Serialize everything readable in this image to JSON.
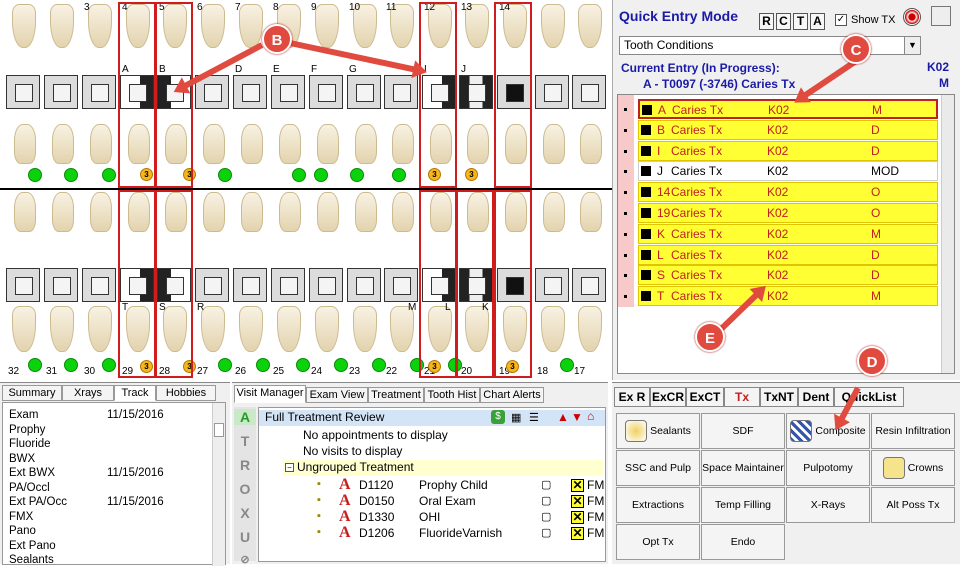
{
  "chart": {
    "upper_numbers": [
      "3",
      "4",
      "5",
      "6",
      "7",
      "8",
      "9",
      "10",
      "11",
      "12",
      "13",
      "14"
    ],
    "upper_letters": [
      "A",
      "B",
      "D",
      "E",
      "F",
      "G",
      "I",
      "J"
    ],
    "lower_numbers": [
      "32",
      "31",
      "30",
      "29",
      "28",
      "27",
      "26",
      "25",
      "24",
      "23",
      "22",
      "21",
      "20",
      "19",
      "18",
      "17"
    ],
    "lower_letters": [
      "T",
      "S",
      "R",
      "M",
      "L",
      "K"
    ],
    "badge": "3",
    "upper_badge_pos": [
      140,
      183,
      428,
      465
    ],
    "lower_badge_pos": [
      140,
      183,
      428,
      506
    ]
  },
  "callouts": {
    "b": "B",
    "c": "C",
    "d": "D",
    "e": "E"
  },
  "quick_entry": {
    "title": "Quick Entry Mode",
    "buttons": [
      "R",
      "C",
      "T",
      "A"
    ],
    "show_tx_label": "Show TX",
    "show_tx_checked": "✓",
    "dropdown_value": "Tooth Conditions",
    "current_entry_label": "Current Entry (In Progress):",
    "current_entry_detail": "A - T0097  (-3746)    Caries Tx",
    "code": "K02",
    "surface": "M"
  },
  "entries": [
    {
      "tooth": "A",
      "cond": "Caries Tx",
      "code": "K02",
      "surf": "M",
      "state": "first"
    },
    {
      "tooth": "B",
      "cond": "Caries Tx",
      "code": "K02",
      "surf": "D",
      "state": "yellow"
    },
    {
      "tooth": "I",
      "cond": "Caries Tx",
      "code": "K02",
      "surf": "D",
      "state": "yellow"
    },
    {
      "tooth": "J",
      "cond": "Caries Tx",
      "code": "K02",
      "surf": "MOD",
      "state": "white"
    },
    {
      "tooth": "14",
      "cond": "Caries Tx",
      "code": "K02",
      "surf": "O",
      "state": "yellow"
    },
    {
      "tooth": "19",
      "cond": "Caries Tx",
      "code": "K02",
      "surf": "O",
      "state": "yellow"
    },
    {
      "tooth": "K",
      "cond": "Caries Tx",
      "code": "K02",
      "surf": "M",
      "state": "yellow"
    },
    {
      "tooth": "L",
      "cond": "Caries Tx",
      "code": "K02",
      "surf": "D",
      "state": "yellow"
    },
    {
      "tooth": "S",
      "cond": "Caries Tx",
      "code": "K02",
      "surf": "D",
      "state": "yellow"
    },
    {
      "tooth": "T",
      "cond": "Caries Tx",
      "code": "K02",
      "surf": "M",
      "state": "yellow"
    }
  ],
  "left_tabs": [
    "Summary",
    "Xrays",
    "Track",
    "Hobbies"
  ],
  "track": [
    {
      "label": "Exam",
      "date": "11/15/2016"
    },
    {
      "label": "Prophy",
      "date": ""
    },
    {
      "label": "Fluoride",
      "date": ""
    },
    {
      "label": "BWX",
      "date": ""
    },
    {
      "label": "Ext BWX",
      "date": "11/15/2016"
    },
    {
      "label": "PA/Occl",
      "date": ""
    },
    {
      "label": "Ext PA/Occ",
      "date": "11/15/2016"
    },
    {
      "label": "FMX",
      "date": ""
    },
    {
      "label": "Pano",
      "date": ""
    },
    {
      "label": "Ext Pano",
      "date": ""
    },
    {
      "label": "Sealants",
      "date": ""
    }
  ],
  "visit_tabs": [
    "Visit Manager",
    "Exam View",
    "Treatment",
    "Tooth Hist",
    "Chart Alerts"
  ],
  "side_letters": [
    "A",
    "T",
    "R",
    "O",
    "X",
    "U"
  ],
  "visit": {
    "title": "Full Treatment Review",
    "no_appts": "No appointments to display",
    "no_visits": "No visits to display",
    "ungrouped": "Ungrouped Treatment",
    "items": [
      {
        "code": "D1120",
        "desc": "Prophy Child",
        "fm": "FM"
      },
      {
        "code": "D0150",
        "desc": "Oral Exam",
        "fm": "FM"
      },
      {
        "code": "D1330",
        "desc": "OHI",
        "fm": "FM"
      },
      {
        "code": "D1206",
        "desc": "FluorideVarnish",
        "fm": "FM"
      }
    ]
  },
  "tx_tabs": [
    "Ex R",
    "ExCR",
    "ExCT",
    "Tx",
    "TxNT",
    "Dent",
    "QuickList"
  ],
  "tx_buttons": [
    "Sealants",
    "SDF",
    "Composite",
    "Resin Infiltration",
    "SSC and Pulp",
    "Space Maintainer",
    "Pulpotomy",
    "Crowns",
    "Extractions",
    "Temp Filling",
    "X-Rays",
    "Alt Poss Tx",
    "Opt Tx",
    "Endo"
  ]
}
